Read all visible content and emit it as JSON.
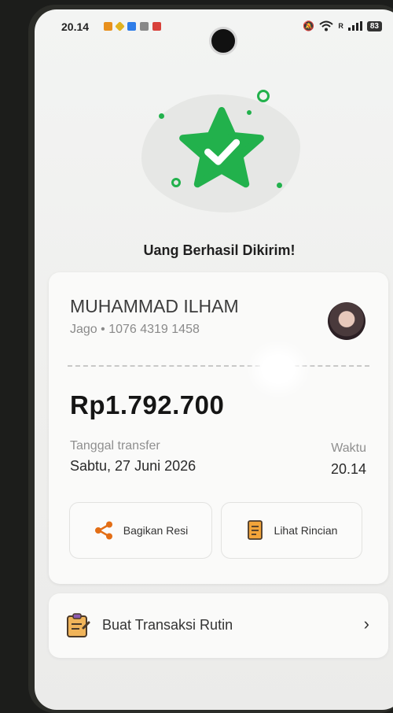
{
  "status_bar": {
    "time": "20.14",
    "battery": "83",
    "network": "R"
  },
  "success": {
    "title": "Uang Berhasil Dikirim!",
    "brand_color": "#22b14c"
  },
  "receipt": {
    "recipient_name": "MUHAMMAD ILHAM",
    "bank_account": "Jago • 1076 4319 1458",
    "amount": "Rp1.792.700",
    "date_label": "Tanggal transfer",
    "date_value": "Sabtu, 27 Juni 2026",
    "time_label": "Waktu",
    "time_value": "20.14",
    "share_label": "Bagikan Resi",
    "details_label": "Lihat Rincian"
  },
  "routine": {
    "label": "Buat Transaksi Rutin"
  }
}
